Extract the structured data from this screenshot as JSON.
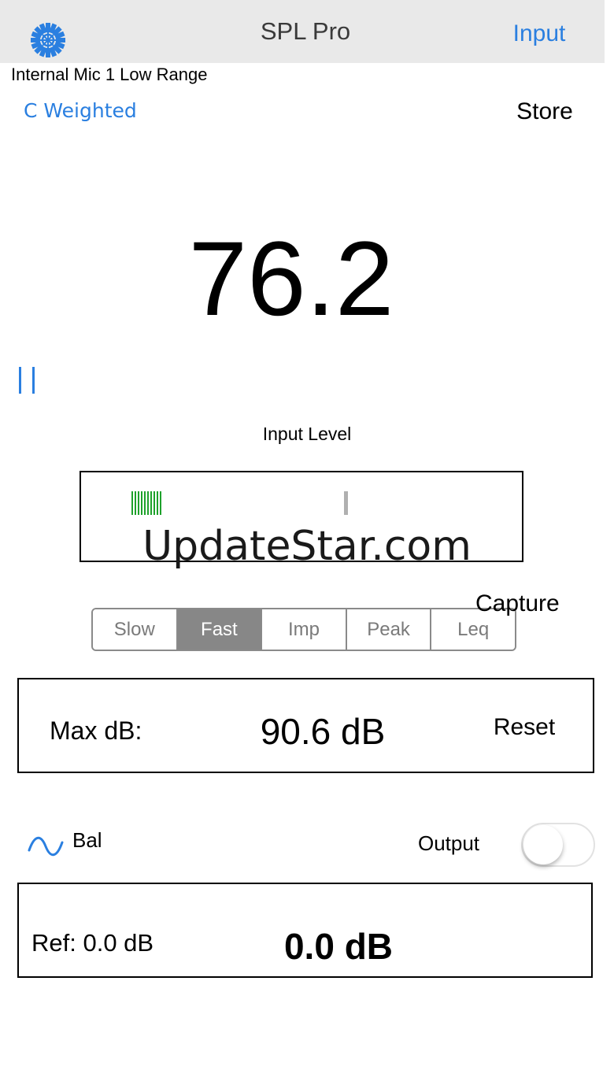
{
  "navbar": {
    "title": "SPL Pro",
    "left_icon": "gear-icon",
    "right_button": "Input"
  },
  "meter": {
    "mic_source": "Internal Mic 1 Low Range",
    "weighting": "C Weighted",
    "store_label": "Store",
    "reading": "76.2",
    "pause_icon": "pause-icon"
  },
  "input_level": {
    "label": "Input Level",
    "watermark": "UpdateStar.com",
    "bar_color": "#1ea12b"
  },
  "response": {
    "options": [
      "Slow",
      "Fast",
      "Imp",
      "Peak",
      "Leq"
    ],
    "selected": "Fast",
    "capture_label": "Capture"
  },
  "max": {
    "label": "Max dB:",
    "value": "90.6 dB",
    "reset_label": "Reset"
  },
  "output": {
    "signal_icon": "sine-wave-icon",
    "bal_label": "Bal",
    "output_label": "Output",
    "output_enabled": false
  },
  "reference": {
    "label": "Ref:  0.0 dB",
    "value": "0.0 dB"
  },
  "colors": {
    "accent": "#2a7fe0",
    "navbar_bg": "#e9e9e9",
    "segment_active": "#878787"
  }
}
